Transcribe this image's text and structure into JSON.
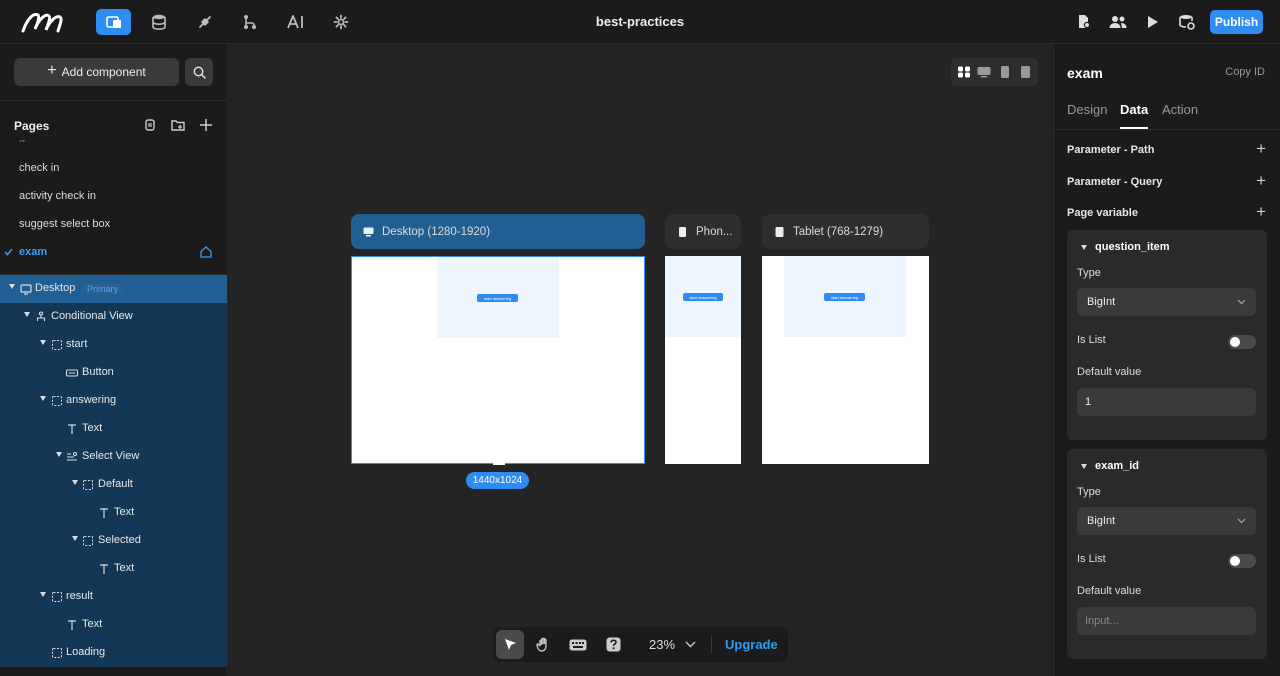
{
  "app": {
    "title": "best-practices",
    "publish_label": "Publish",
    "nav_icons": [
      "pages-icon",
      "database-icon",
      "api-icon",
      "workflow-icon",
      "ai-icon",
      "settings-icon"
    ],
    "accent": "#2f8cf0"
  },
  "left": {
    "add_component_label": "Add component",
    "pages_title": "Pages",
    "pages": [
      {
        "label": "check in"
      },
      {
        "label": "activity check in"
      },
      {
        "label": "suggest select box"
      },
      {
        "label": "exam",
        "active": true
      }
    ],
    "tree": {
      "desktop": "Desktop",
      "primary_badge": "Primary",
      "conditional_view": "Conditional View",
      "start": "start",
      "button": "Button",
      "answering": "answering",
      "text1": "Text",
      "select_view": "Select View",
      "default": "Default",
      "text2": "Text",
      "selected": "Selected",
      "text3": "Text",
      "result": "result",
      "text4": "Text",
      "loading": "Loading"
    }
  },
  "canvas": {
    "frames": [
      {
        "label": "Desktop (1280-1920)"
      },
      {
        "label": "Phon..."
      },
      {
        "label": "Tablet (768-1279)"
      }
    ],
    "mini_button_label": "start answering",
    "size_badge": "1440x1024",
    "zoom": "23%",
    "upgrade_label": "Upgrade"
  },
  "right": {
    "title": "exam",
    "copy_id_label": "Copy ID",
    "tabs": [
      {
        "label": "Design"
      },
      {
        "label": "Data",
        "active": true
      },
      {
        "label": "Action"
      }
    ],
    "param_path": "Parameter - Path",
    "param_query": "Parameter - Query",
    "page_variable": "Page variable",
    "variables": [
      {
        "name": "question_item",
        "type_label": "Type",
        "type_value": "BigInt",
        "is_list_label": "Is List",
        "is_list": false,
        "default_label": "Default value",
        "default_value": "1",
        "default_placeholder": ""
      },
      {
        "name": "exam_id",
        "type_label": "Type",
        "type_value": "BigInt",
        "is_list_label": "Is List",
        "is_list": false,
        "default_label": "Default value",
        "default_value": "",
        "default_placeholder": "Input..."
      }
    ]
  }
}
